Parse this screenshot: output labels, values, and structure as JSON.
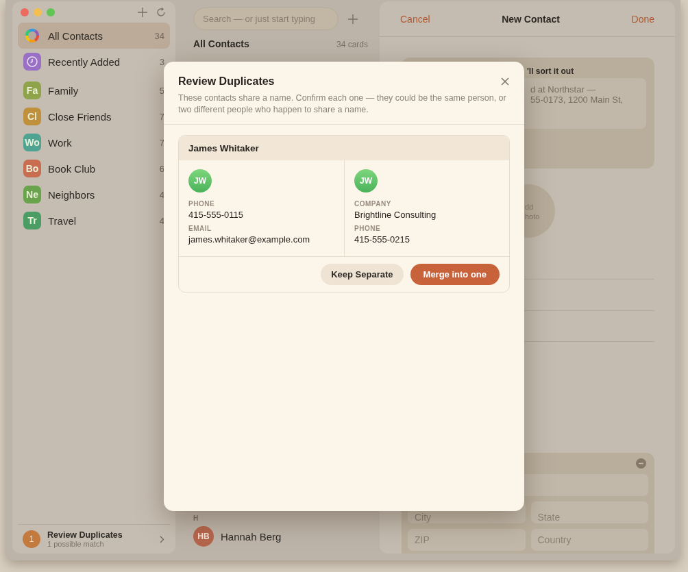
{
  "sidebar": {
    "groups": [
      {
        "label": "All Contacts",
        "count": "34",
        "kind": "ring",
        "selected": true
      },
      {
        "label": "Recently Added",
        "count": "3",
        "kind": "clock",
        "color": "#9a70c4",
        "selected": false
      },
      {
        "label": "Family",
        "count": "5",
        "kind": "initials",
        "initials": "Fa",
        "color": "#8fa34a",
        "selected": false
      },
      {
        "label": "Close Friends",
        "count": "7",
        "kind": "initials",
        "initials": "Cl",
        "color": "#bf913d",
        "selected": false
      },
      {
        "label": "Work",
        "count": "7",
        "kind": "initials",
        "initials": "Wo",
        "color": "#4fa390",
        "selected": false
      },
      {
        "label": "Book Club",
        "count": "6",
        "kind": "initials",
        "initials": "Bo",
        "color": "#c86d4f",
        "selected": false
      },
      {
        "label": "Neighbors",
        "count": "4",
        "kind": "initials",
        "initials": "Ne",
        "color": "#69a34b",
        "selected": false
      },
      {
        "label": "Travel",
        "count": "4",
        "kind": "initials",
        "initials": "Tr",
        "color": "#4c9d63",
        "selected": false
      }
    ],
    "footer": {
      "badge": "1",
      "title": "Review Duplicates",
      "subtitle": "1 possible match"
    }
  },
  "contact_list": {
    "search": {
      "placeholder": "Search — or just start typing"
    },
    "heading": "All Contacts",
    "count": "34 cards",
    "sections": [
      {
        "letter": "H",
        "contacts": [
          {
            "initials": "HB",
            "name": "Hannah Berg"
          }
        ]
      }
    ]
  },
  "detail": {
    "cancel": "Cancel",
    "title": "New Contact",
    "done": "Done",
    "notes_card": {
      "title": "'ll sort it out",
      "lines": [
        "d at Northstar —",
        "55-0173, 1200 Main St,"
      ]
    },
    "photo": {
      "lines": [
        "dd",
        "hoto"
      ]
    },
    "address": {
      "rows": [
        [
          {
            "placeholder": "City"
          },
          {
            "placeholder": "State"
          }
        ],
        [
          {
            "placeholder": "ZIP"
          },
          {
            "placeholder": "Country"
          }
        ]
      ]
    }
  },
  "dialog": {
    "title": "Review Duplicates",
    "description": "These contacts share a name. Confirm each one — they could be the same person, or two different people who happen to share a name.",
    "groups": [
      {
        "name": "James Whitaker",
        "records": [
          {
            "initials": "JW",
            "fields": [
              {
                "label": "PHONE",
                "value": "415-555-0115"
              },
              {
                "label": "EMAIL",
                "value": "james.whitaker@example.com"
              }
            ]
          },
          {
            "initials": "JW",
            "fields": [
              {
                "label": "COMPANY",
                "value": "Brightline Consulting"
              },
              {
                "label": "PHONE",
                "value": "415-555-0215"
              }
            ]
          }
        ]
      }
    ],
    "buttons": [
      {
        "label": "Keep Separate",
        "kind": "secondary"
      },
      {
        "label": "Merge into one",
        "kind": "primary"
      }
    ]
  }
}
